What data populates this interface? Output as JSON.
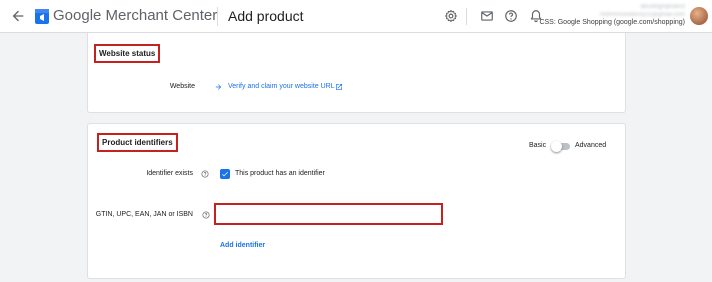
{
  "header": {
    "back_icon": "arrow-back-icon",
    "logo_icon": "merchant-center-logo",
    "app_name": "Google Merchant Center",
    "page_title": "Add product",
    "icons": [
      "settings-icon",
      "mail-icon",
      "help-icon",
      "notifications-icon"
    ],
    "account": {
      "line1": "abcdefghijklabcd",
      "line2": "mdmmnoedalsvy11@gmail.com",
      "store": "CSS: Google Shopping (google.com/shopping)"
    }
  },
  "website_status": {
    "title": "Website status",
    "website_label": "Website",
    "verify_link": "Verify and claim your website URL"
  },
  "product_identifiers": {
    "title": "Product identifiers",
    "toggle_basic": "Basic",
    "toggle_advanced": "Advanced",
    "identifier_exists_label": "Identifier exists",
    "identifier_checkbox_label": "This product has an identifier",
    "gtin_label": "GTIN, UPC, EAN, JAN or ISBN",
    "gtin_value": "",
    "add_identifier": "Add identifier"
  },
  "colors": {
    "accent": "#1a73e8",
    "highlight_border": "#c5221f"
  }
}
